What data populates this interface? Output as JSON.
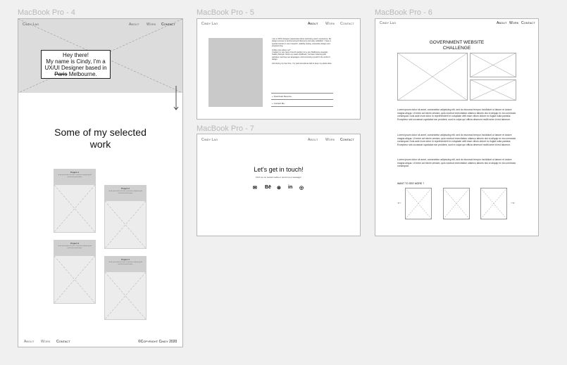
{
  "frames": {
    "mb4": "MacBook Pro - 4",
    "mb5": "MacBook Pro - 5",
    "mb6": "MacBook Pro - 6",
    "mb7": "MacBook Pro - 7"
  },
  "nav": {
    "logo": "Cindy Lao",
    "about": "About",
    "work": "Work",
    "contact": "Contact"
  },
  "home": {
    "hero_line1": "Hey there!",
    "hero_line2": "My name is Cindy, I'm a",
    "hero_line3": "UX/UI Designer based in",
    "hero_struck": "Paris",
    "hero_city": "Melbourne.",
    "section_title_1": "Some of my selected",
    "section_title_2": "work",
    "cards": [
      {
        "title": "Project 1",
        "text": "Lorem ipsum dolor sit amet, consectetur adipiscing elit sed do eiusmod tempor"
      },
      {
        "title": "Project 2",
        "text": "Lorem ipsum dolor sit amet, consectetur adipiscing elit sed do eiusmod tempor"
      },
      {
        "title": "Project 3",
        "text": "Lorem ipsum dolor sit amet, consectetur adipiscing elit sed do eiusmod tempor"
      },
      {
        "title": "Project 4",
        "text": "Lorem ipsum dolor sit amet, consectetur adipiscing elit sed do eiusmod tempor"
      }
    ],
    "footer_about": "About",
    "footer_work": "Work",
    "footer_contact": "Contact",
    "copyright": "©Copyright Cindy 2020"
  },
  "about": {
    "p1": "I am a UX/UI designer passionate about optimising users' experience. My design process is centred around discovery and early validation. I have a special interest in user research, usability testing, interaction design and programming.",
    "q": "A little more about me?",
    "p2": "I traded my very fancy French position for a very Melbourne avocado-healthy lifestyle. Since my sweet childhood, I've been tinkering with websites, learning new languages, and immersing myself in the world of design.",
    "p3": "And during my free time, I try (and sometimes fail) to keep my plants alive.",
    "download": "Download Resume",
    "contact": "Contact Me"
  },
  "project": {
    "title_1": "GOVERNMENT WEBSITE",
    "title_2": "CHALLENGE",
    "p1": "Lorem ipsum dolor sit amet, consectetur adipiscing elit, sed do eiusmod tempor incididunt ut labore et dolore magna aliqua. Ut enim ad minim veniam, quis nostrud exercitation ullamco laboris nisi ut aliquip ex ea commodo consequat. Duis aute irure dolor in reprehenderit in voluptate velit esse cillum dolore eu fugiat nulla pariatur. Excepteur sint occaecat cupidatat non proident, sunt in culpa qui officia deserunt mollit anim id est laborum.",
    "p2": "Lorem ipsum dolor sit amet, consectetur adipiscing elit, sed do eiusmod tempor incididunt ut labore et dolore magna aliqua. Ut enim ad minim veniam, quis nostrud exercitation ullamco laboris nisi ut aliquip ex ea commodo consequat. Duis aute irure dolor in reprehenderit in voluptate velit esse cillum dolore eu fugiat nulla pariatur. Excepteur sint occaecat cupidatat non proident, sunt in culpa qui officia deserunt mollit anim id est laborum.",
    "p3": "Lorem ipsum dolor sit amet, consectetur adipiscing elit, sed do eiusmod tempor incididunt ut labore et dolore magna aliqua. Ut enim ad minim veniam, quis nostrud exercitation ullamco laboris nisi ut aliquip ex ea commodo consequat.",
    "more": "WANT TO SEE MORE ?",
    "prev": "←",
    "next": "→"
  },
  "contact_page": {
    "title": "Let's get in touch!",
    "subtitle": "Find me on social media or send me a message!",
    "icons": {
      "mail": "✉",
      "behance": "Bē",
      "dribbble": "⊛",
      "linkedin": "in",
      "instagram": "◎"
    }
  }
}
